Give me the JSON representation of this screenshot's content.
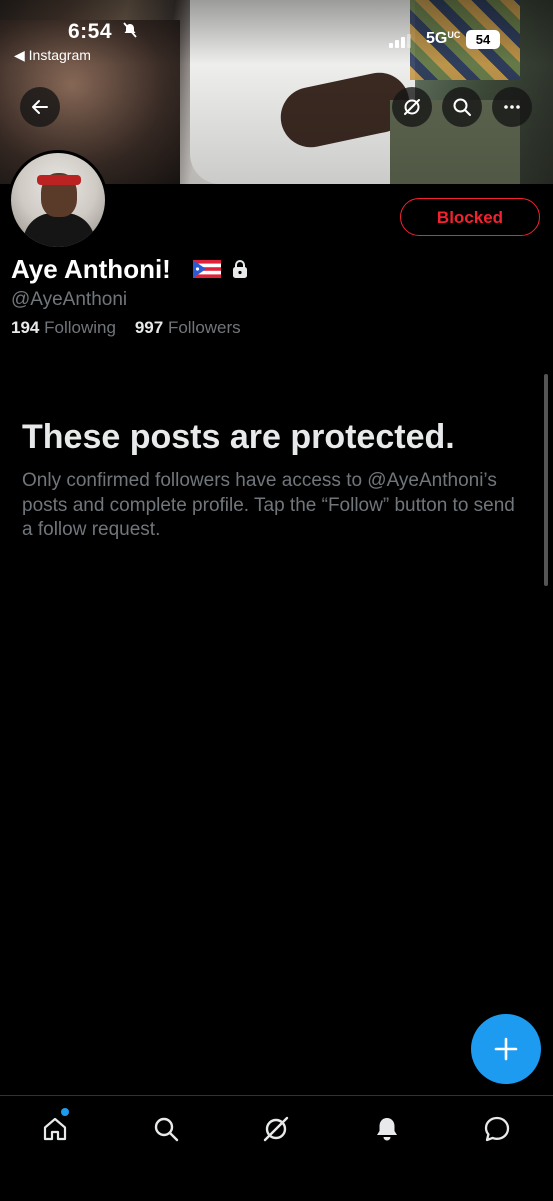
{
  "status_bar": {
    "time": "6:54",
    "back_app": "◀ Instagram",
    "network": "5G",
    "network_suffix": "UC",
    "battery": "54"
  },
  "header": {
    "back_icon": "arrow-left-icon",
    "grok_icon": "grok-icon",
    "search_icon": "search-icon",
    "more_icon": "more-icon"
  },
  "profile": {
    "name": "Aye Anthoni!",
    "flag": "puerto-rico-flag-icon",
    "lock_icon": "lock-icon",
    "handle": "@AyeAnthoni",
    "following_count": "194",
    "following_label": "Following",
    "followers_count": "997",
    "followers_label": "Followers",
    "status_button": "Blocked"
  },
  "protected": {
    "title": "These posts are protected.",
    "body": "Only confirmed followers have access to @AyeAnthoni’s posts and complete profile. Tap the “Follow” button to send a follow request."
  },
  "fab": {
    "icon": "plus-icon"
  },
  "tabbar": {
    "items": [
      "home-icon",
      "search-icon",
      "grok-icon",
      "notifications-icon",
      "messages-icon"
    ],
    "home_has_badge": true
  },
  "colors": {
    "accent": "#1d9bf0",
    "blocked": "#f4212e",
    "secondary_text": "#71767b",
    "primary_text": "#e7e9ea"
  }
}
